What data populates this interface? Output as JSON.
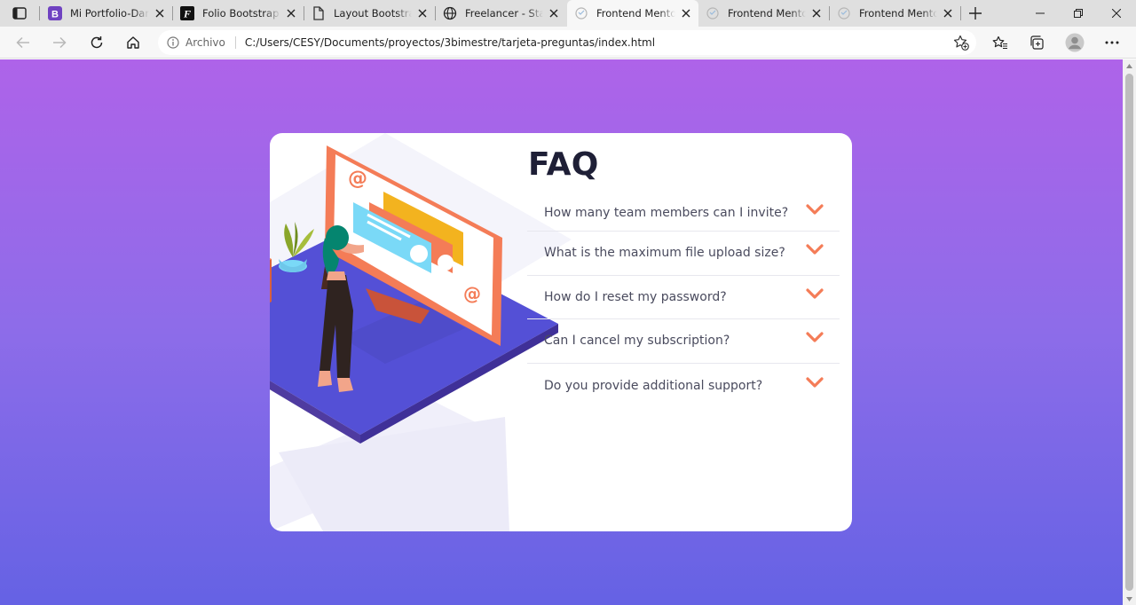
{
  "browser": {
    "tabs": [
      {
        "title": "Mi Portfolio-Daniel",
        "favicon": "bootstrap-icon",
        "active": false
      },
      {
        "title": "Folio Bootstrap Template",
        "favicon": "folio-icon",
        "active": false
      },
      {
        "title": "Layout Bootstrap",
        "favicon": "document-icon",
        "active": false
      },
      {
        "title": "Freelancer - Start Bootstrap",
        "favicon": "globe-icon",
        "active": false
      },
      {
        "title": "Frontend Mentor",
        "favicon": "frontend-mentor-icon",
        "active": true
      },
      {
        "title": "Frontend Mentor",
        "favicon": "frontend-mentor-icon",
        "active": false
      },
      {
        "title": "Frontend Mentor",
        "favicon": "frontend-mentor-icon",
        "active": false
      }
    ],
    "address": {
      "site_label": "Archivo",
      "url": "C:/Users/CESY/Documents/proyectos/3bimestre/tarjeta-preguntas/index.html"
    }
  },
  "page": {
    "faq_title": "FAQ",
    "questions": [
      "How many team members can I invite?",
      "What is the maximum file upload size?",
      "How do I reset my password?",
      "Can I cancel my subscription?",
      "Do you provide additional support?"
    ],
    "colors": {
      "gradient_top": "#ae63e9",
      "gradient_bottom": "#6562e4",
      "accent": "#f47c57",
      "heading": "#1e1f36",
      "text": "#4a4b5e"
    }
  }
}
